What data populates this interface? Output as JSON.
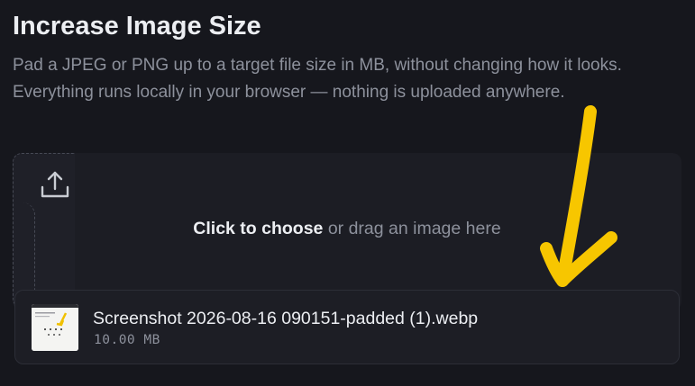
{
  "header": {
    "title": "Increase Image Size",
    "description": "Pad a JPEG or PNG up to a target file size in MB, without changing how it looks. Everything runs locally in your browser — nothing is uploaded anywhere."
  },
  "dropzone": {
    "action_bold": "Click to choose",
    "action_rest": " or drag an image here",
    "icon": "upload-icon"
  },
  "file": {
    "name": "Screenshot 2026-08-16 090151-padded (1).webp",
    "size": "10.00 MB"
  },
  "colors": {
    "background": "#16171d",
    "panel": "#1c1d24",
    "text_primary": "#eceef2",
    "text_muted": "#8d919c",
    "annotation": "#f7c600"
  }
}
